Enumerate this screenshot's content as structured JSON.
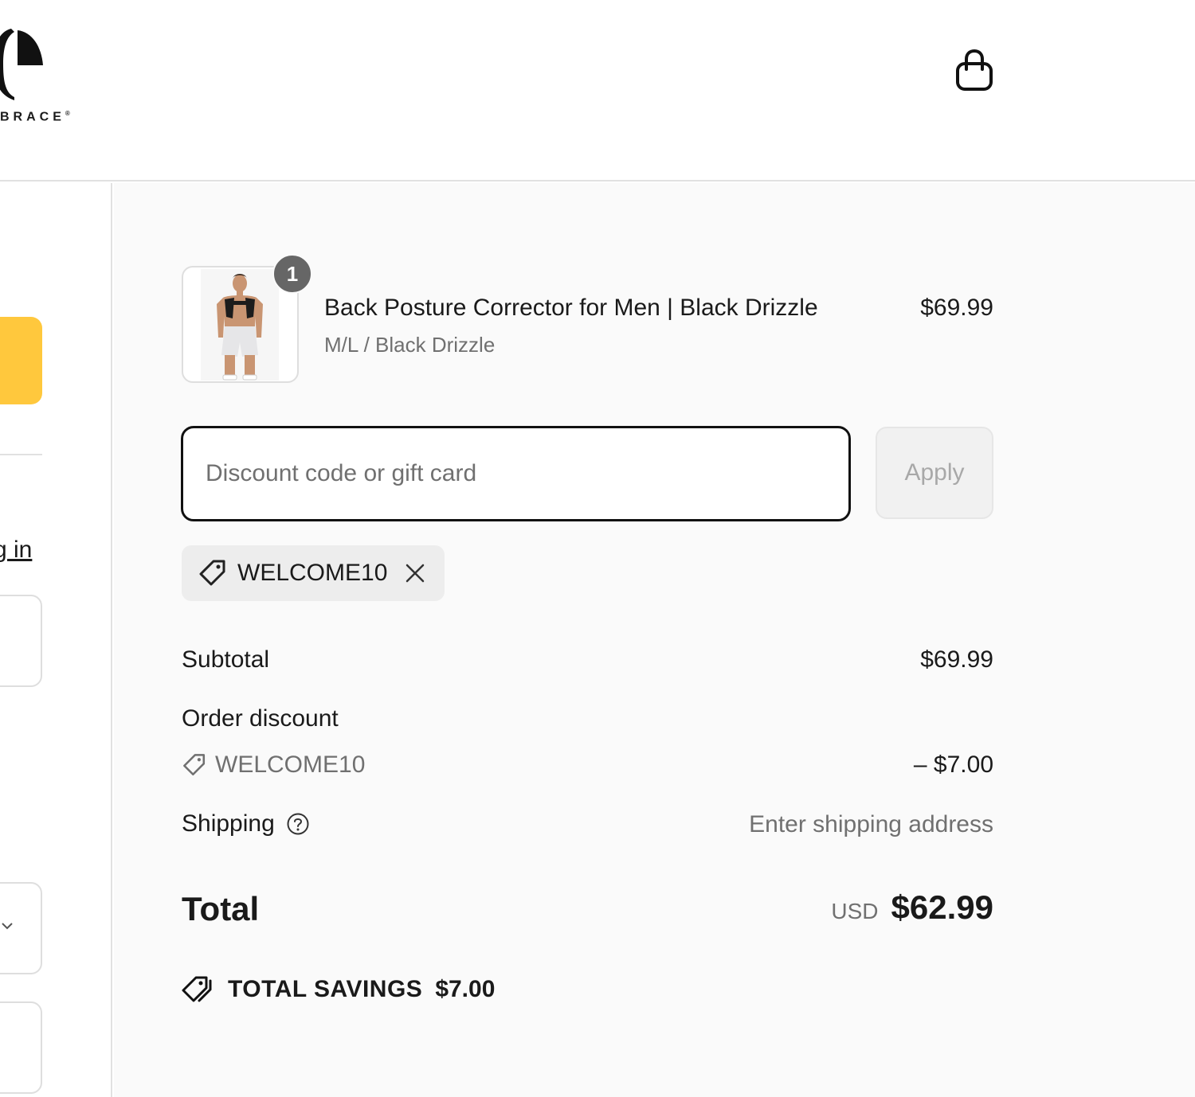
{
  "header": {
    "logo_text": "BRACE",
    "logo_mark": "®",
    "cart_icon": "shopping-bag-icon"
  },
  "left_fragments": {
    "login_text": "g in"
  },
  "order": {
    "item": {
      "quantity": "1",
      "title": "Back Posture Corrector for Men | Black Drizzle",
      "variant": "M/L / Black Drizzle",
      "price": "$69.99"
    },
    "discount": {
      "placeholder": "Discount code or gift card",
      "value": "",
      "apply_label": "Apply",
      "applied_code": "WELCOME10"
    },
    "summary": {
      "subtotal_label": "Subtotal",
      "subtotal_value": "$69.99",
      "order_discount_label": "Order discount",
      "discount_code": "WELCOME10",
      "discount_value": "– $7.00",
      "shipping_label": "Shipping",
      "shipping_value": "Enter shipping address",
      "total_label": "Total",
      "currency": "USD",
      "total_value": "$62.99",
      "savings_label": "TOTAL SAVINGS",
      "savings_value": "$7.00"
    }
  },
  "colors": {
    "accent_yellow": "#ffc83d",
    "panel_bg": "#fafafa",
    "muted_text": "#707070",
    "badge_bg": "#666666"
  }
}
